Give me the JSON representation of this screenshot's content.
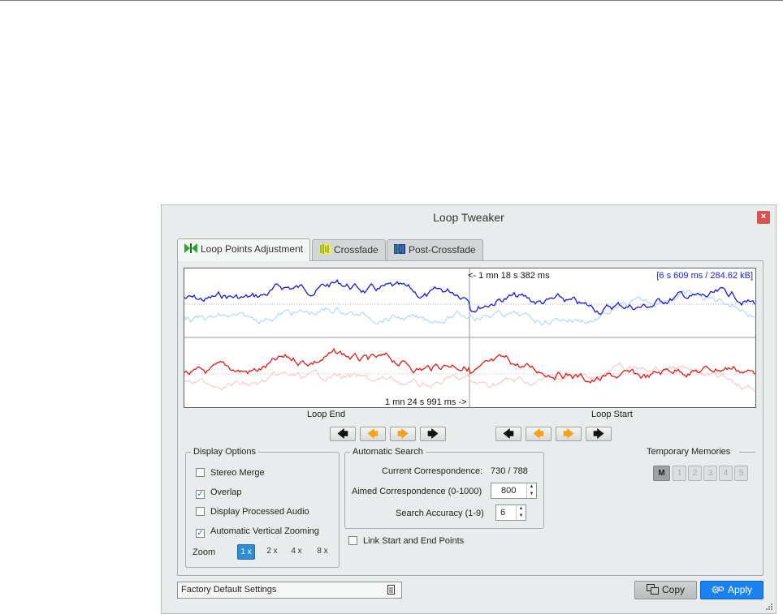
{
  "window": {
    "title": "Loop Tweaker",
    "close_label": "×"
  },
  "tabs": [
    {
      "label": "Loop Points Adjustment",
      "active": true,
      "icon": "loop-points-icon"
    },
    {
      "label": "Crossfade",
      "active": false,
      "icon": "crossfade-icon"
    },
    {
      "label": "Post-Crossfade",
      "active": false,
      "icon": "post-crossfade-icon"
    }
  ],
  "waveform": {
    "loop_start_time": "<- 1 mn 18 s 382 ms",
    "loop_info": "[6 s 609 ms / 284.62 kB]",
    "loop_end_time": "1 mn 24 s 991 ms ->",
    "upper_channel_color": "#1a1ad6",
    "lower_channel_color": "#e01a1a"
  },
  "labels": {
    "loop_end": "Loop End",
    "loop_start": "Loop Start"
  },
  "nav_buttons": {
    "loop_end": [
      "arrow-left-black",
      "arrow-left-orange",
      "arrow-right-orange",
      "arrow-right-black"
    ],
    "loop_start": [
      "arrow-left-black",
      "arrow-left-orange",
      "arrow-right-orange",
      "arrow-right-black"
    ],
    "glyphs": {
      "left": "🡄",
      "right": "🡆"
    }
  },
  "display_options": {
    "title": "Display Options",
    "items": [
      {
        "label": "Stereo Merge",
        "checked": false
      },
      {
        "label": "Overlap",
        "checked": true
      },
      {
        "label": "Display Processed Audio",
        "checked": false
      },
      {
        "label": "Automatic Vertical Zooming",
        "checked": true
      }
    ],
    "zoom_label": "Zoom",
    "zoom_options": [
      "1 x",
      "2 x",
      "4 x",
      "8 x"
    ],
    "zoom_selected": "1 x",
    "check_glyph": "✓"
  },
  "automatic_search": {
    "title": "Automatic Search",
    "current_label": "Current Correspondence:",
    "current_value": "730 / 788",
    "aimed_label": "Aimed Correspondence (0-1000)",
    "aimed_value": "800",
    "accuracy_label": "Search Accuracy (1-9)",
    "accuracy_value": "6"
  },
  "link_points": {
    "label": "Link Start and End Points",
    "checked": false
  },
  "temporary_memories": {
    "title": "Temporary Memories",
    "buttons": [
      "M",
      "1",
      "2",
      "3",
      "4",
      "5"
    ]
  },
  "preset": {
    "value": "Factory Default Settings"
  },
  "footer": {
    "copy_label": "Copy",
    "apply_label": "Apply",
    "accent_color": "#1a82f0"
  }
}
